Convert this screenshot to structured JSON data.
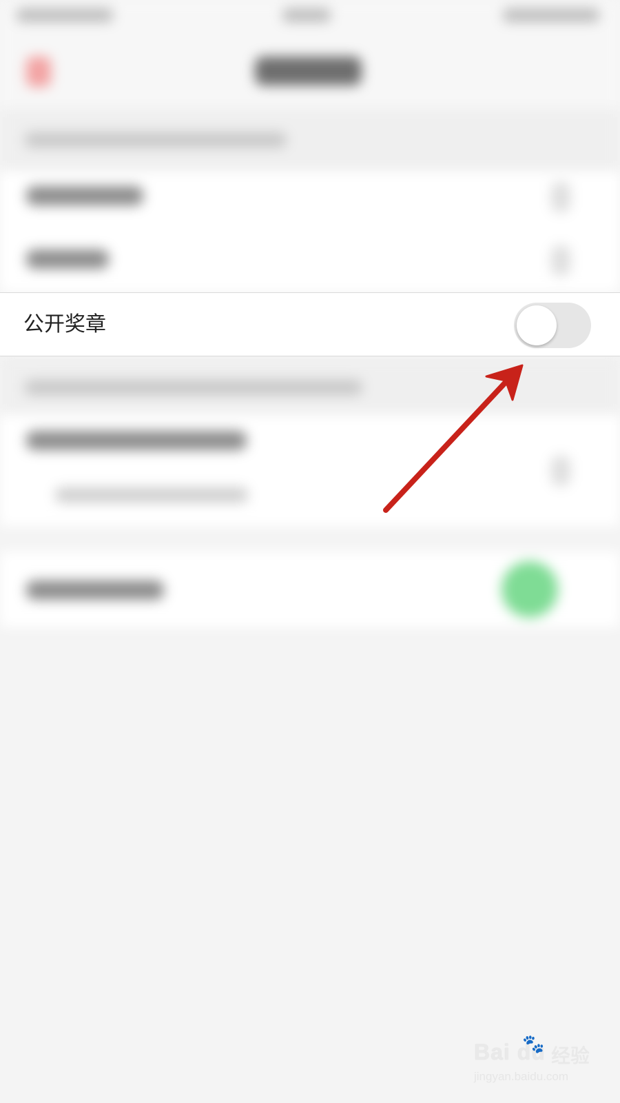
{
  "settings": {
    "public_badges": {
      "label": "公开奖章",
      "toggle_on": false
    }
  },
  "watermark": {
    "brand": "Bai du",
    "paw": "🐾",
    "cn": "经验",
    "url": "jingyan.baidu.com"
  },
  "colors": {
    "arrow": "#c8221a",
    "toggle_off_track": "#e6e6e6",
    "toggle_on_track": "#4cd964"
  }
}
